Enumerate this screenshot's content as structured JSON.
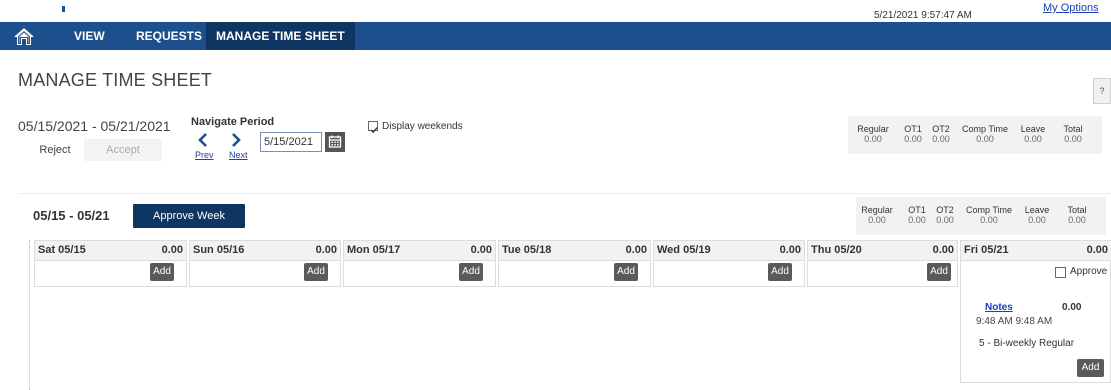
{
  "header": {
    "datetime": "5/21/2021 9:57:47 AM",
    "my_options": "My Options"
  },
  "nav": {
    "items": [
      {
        "label": "VIEW"
      },
      {
        "label": "REQUESTS"
      },
      {
        "label": "MANAGE TIME SHEET"
      }
    ]
  },
  "page": {
    "title": "MANAGE TIME SHEET",
    "help": "?"
  },
  "period": {
    "range": "05/15/2021 - 05/21/2021",
    "reject": "Reject",
    "accept": "Accept",
    "navigate_label": "Navigate Period",
    "prev": "Prev",
    "next": "Next",
    "date_value": "5/15/2021",
    "display_weekends_label": "Display weekends",
    "display_weekends_checked": true
  },
  "period_totals": {
    "headers": [
      "Regular",
      "OT1",
      "OT2",
      "Comp Time",
      "Leave",
      "Total"
    ],
    "values": [
      "0.00",
      "0.00",
      "0.00",
      "0.00",
      "0.00",
      "0.00"
    ]
  },
  "week": {
    "range": "05/15 - 05/21",
    "approve_week": "Approve Week",
    "totals": {
      "headers": [
        "Regular",
        "OT1",
        "OT2",
        "Comp Time",
        "Leave",
        "Total"
      ],
      "values": [
        "0.00",
        "0.00",
        "0.00",
        "0.00",
        "0.00",
        "0.00"
      ]
    },
    "days": [
      {
        "name": "Sat 05/15",
        "hours": "0.00",
        "add": "Add"
      },
      {
        "name": "Sun 05/16",
        "hours": "0.00",
        "add": "Add"
      },
      {
        "name": "Mon 05/17",
        "hours": "0.00",
        "add": "Add"
      },
      {
        "name": "Tue 05/18",
        "hours": "0.00",
        "add": "Add"
      },
      {
        "name": "Wed 05/19",
        "hours": "0.00",
        "add": "Add"
      },
      {
        "name": "Thu 05/20",
        "hours": "0.00",
        "add": "Add"
      },
      {
        "name": "Fri 05/21",
        "hours": "0.00",
        "add": "Add"
      }
    ],
    "friday": {
      "approve_label": "Approve",
      "entry": {
        "notes": "Notes",
        "hours": "0.00",
        "time": "9:48 AM  9:48 AM",
        "code": "5 - Bi-weekly Regular"
      }
    }
  },
  "colors": {
    "nav_bg": "#1c4f8c",
    "nav_active": "#0f3563",
    "link": "#1a3fb5"
  }
}
